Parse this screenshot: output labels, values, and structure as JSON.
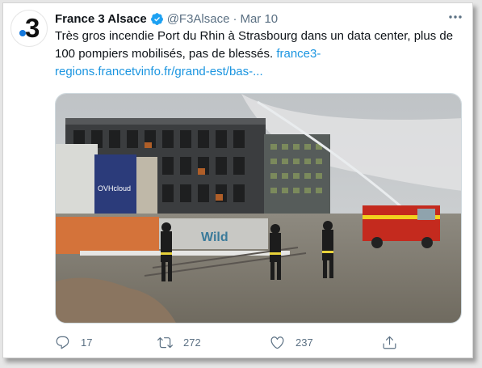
{
  "account": {
    "name": "France 3 Alsace",
    "handle": "@F3Alsace",
    "date": "Mar 10",
    "avatar_glyph": "3",
    "avatar_dot_color": "#1478dc",
    "verified_color": "#1da1f2"
  },
  "tweet": {
    "line1": "Très gros incendie Port du Rhin à Strasbourg dans un data center, plus de",
    "line2_text": "100 pompiers mobilisés, pas de blessés.",
    "link_part1": "france3-",
    "link_part2": "regions.francetvinfo.fr/grand-est/bas-...",
    "link_color": "#1b95e0"
  },
  "photo": {
    "building_sign": "OVHcloud",
    "graffiti": "Wild"
  },
  "actions": {
    "reply_count": "17",
    "retweet_count": "272",
    "like_count": "237"
  },
  "icons": [
    "verified-badge-icon",
    "more-options-icon",
    "reply-icon",
    "retweet-icon",
    "like-icon",
    "share-icon"
  ]
}
